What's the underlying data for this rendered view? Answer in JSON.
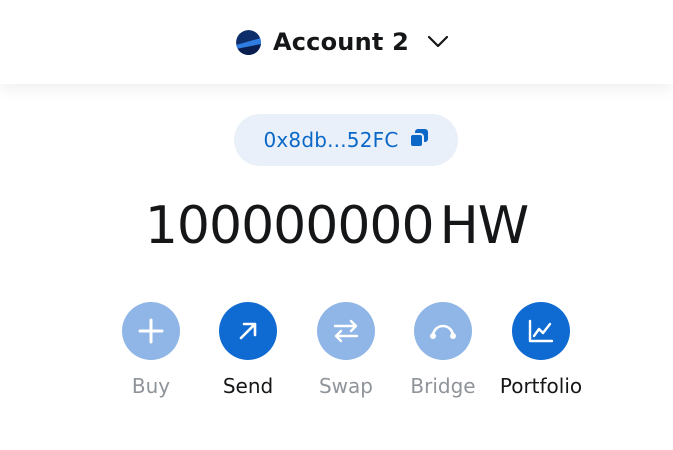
{
  "header": {
    "account_name": "Account 2",
    "avatar_icon": "account-avatar-icon",
    "dropdown_icon": "chevron-down-icon"
  },
  "address": {
    "text": "0x8db...52FC",
    "copy_icon": "copy-icon"
  },
  "balance": {
    "amount": "100000000",
    "unit": "HW"
  },
  "actions": [
    {
      "label": "Buy",
      "icon": "plus-icon",
      "enabled": false
    },
    {
      "label": "Send",
      "icon": "arrow-up-right-icon",
      "enabled": true
    },
    {
      "label": "Swap",
      "icon": "swap-arrows-icon",
      "enabled": false
    },
    {
      "label": "Bridge",
      "icon": "bridge-icon",
      "enabled": false
    },
    {
      "label": "Portfolio",
      "icon": "chart-line-icon",
      "enabled": true
    }
  ],
  "colors": {
    "primary": "#0f6bd2",
    "primary_disabled": "#8fb6e6",
    "address_bg": "#e9f0fa",
    "address_text": "#0b68c7",
    "text": "#141618",
    "text_muted": "#8f949a"
  }
}
